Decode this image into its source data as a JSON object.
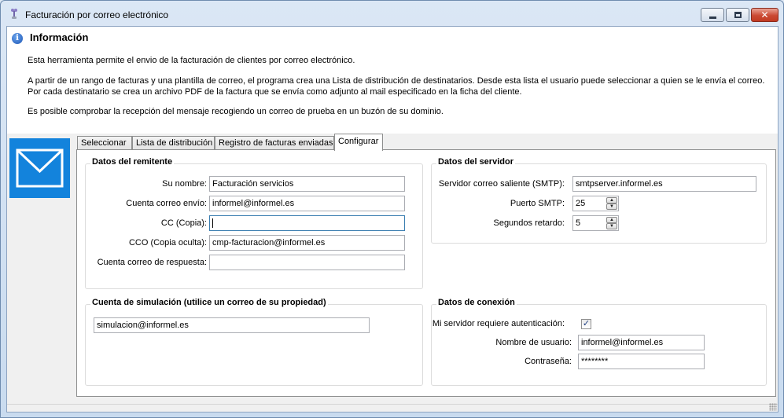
{
  "window": {
    "title": "Facturación por correo electrónico",
    "controls": {
      "minimize": "minimize",
      "maximize": "maximize",
      "close": "close"
    }
  },
  "info": {
    "title": "Información",
    "paragraphs": [
      "Esta herramienta permite el envio de la facturación de clientes por correo electrónico.",
      "A partir de un rango de facturas y una plantilla de correo, el programa crea una Lista de distribución de destinatarios. Desde esta lista el usuario puede seleccionar a quien se le envía el correo. Por cada destinatario se crea un archivo PDF de la factura que se envía como adjunto al mail especificado en la ficha del cliente.",
      "Es posible comprobar la recepción del mensaje recogiendo un correo de prueba en un buzón de su dominio."
    ]
  },
  "tabs": [
    {
      "label": "Seleccionar"
    },
    {
      "label": "Lista de distribución"
    },
    {
      "label": "Registro de facturas enviadas"
    },
    {
      "label": "Configurar",
      "active": true
    }
  ],
  "remitente": {
    "title": "Datos del remitente",
    "nombre_label": "Su nombre:",
    "nombre_value": "Facturación servicios",
    "cuenta_label": "Cuenta correo envío:",
    "cuenta_value": "informel@informel.es",
    "cc_label": "CC (Copia):",
    "cc_value": "",
    "cco_label": "CCO (Copia oculta):",
    "cco_value": "cmp-facturacion@informel.es",
    "respuesta_label": "Cuenta correo de respuesta:",
    "respuesta_value": ""
  },
  "servidor": {
    "title": "Datos del servidor",
    "smtp_label": "Servidor correo saliente (SMTP):",
    "smtp_value": "smtpserver.informel.es",
    "puerto_label": "Puerto SMTP:",
    "puerto_value": "25",
    "retardo_label": "Segundos retardo:",
    "retardo_value": "5"
  },
  "simulacion": {
    "title": "Cuenta de simulación (utilice un correo de su propiedad)",
    "value": "simulacion@informel.es"
  },
  "conexion": {
    "title": "Datos de conexión",
    "auth_label": "Mi servidor requiere autenticación:",
    "auth_checked": true,
    "usuario_label": "Nombre de usuario:",
    "usuario_value": "informel@informel.es",
    "password_label": "Contraseña:",
    "password_value": "********"
  },
  "colors": {
    "mail_tile": "#1383dc",
    "info_icon": "#1d56b6"
  }
}
